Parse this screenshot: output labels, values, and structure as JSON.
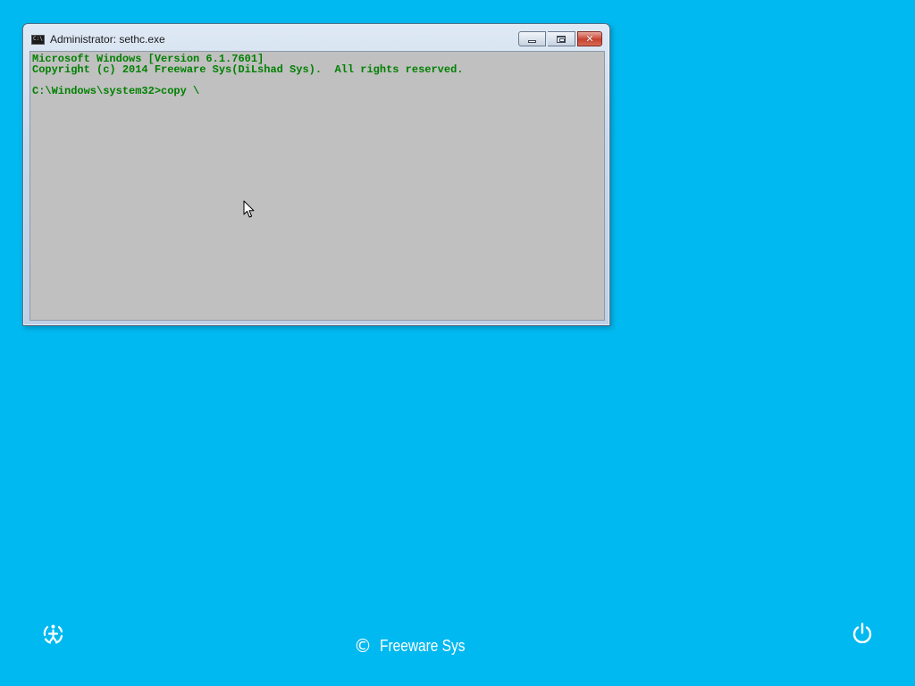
{
  "window": {
    "title": "Administrator: sethc.exe",
    "icon_label": "C:\\",
    "buttons": {
      "minimize": "minimize-icon",
      "maximize": "maximize-icon",
      "close": "close-icon"
    }
  },
  "console": {
    "lines": [
      "Microsoft Windows [Version 6.1.7601]",
      "Copyright (c) 2014 Freeware Sys(DiLshad Sys).  All rights reserved.",
      "",
      "C:\\Windows\\system32>copy \\"
    ],
    "text_color": "#008000",
    "background_color": "#c0c0c0"
  },
  "desktop": {
    "background_color": "#00b9f0"
  },
  "footer": {
    "ease_of_access_icon": "ease-of-access-icon",
    "copyright_symbol": "©",
    "brand": "Freeware Sys",
    "power_icon": "power-icon"
  }
}
